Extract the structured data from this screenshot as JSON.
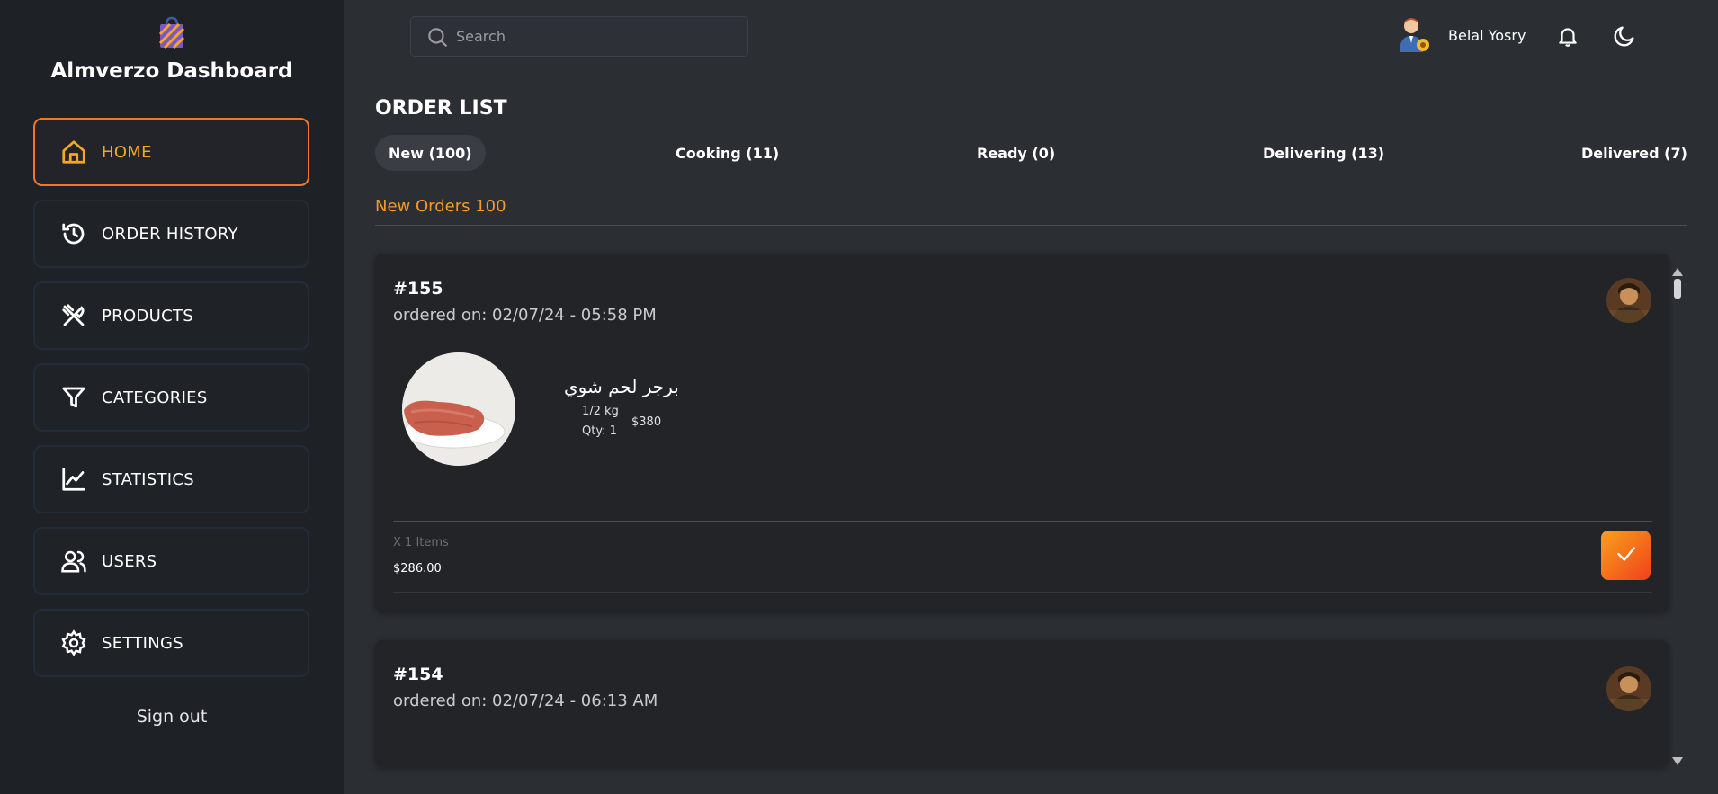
{
  "app": {
    "title": "Almverzo Dashboard",
    "accent": "#f5a623",
    "accent_gradient": [
      "#f7a21b",
      "#f2401b"
    ]
  },
  "sidebar": {
    "items": [
      {
        "label": "HOME",
        "icon": "home-icon",
        "active": true
      },
      {
        "label": "ORDER HISTORY",
        "icon": "history-icon",
        "active": false
      },
      {
        "label": "PRODUCTS",
        "icon": "utensils-icon",
        "active": false
      },
      {
        "label": "CATEGORIES",
        "icon": "filter-icon",
        "active": false
      },
      {
        "label": "STATISTICS",
        "icon": "chart-icon",
        "active": false
      },
      {
        "label": "USERS",
        "icon": "users-icon",
        "active": false
      },
      {
        "label": "SETTINGS",
        "icon": "gear-icon",
        "active": false
      }
    ],
    "signout_label": "Sign out"
  },
  "topbar": {
    "search_placeholder": "Search",
    "user_name": "Belal Yosry"
  },
  "main": {
    "title": "ORDER LIST",
    "tabs": [
      {
        "label": "New (100)",
        "active": true
      },
      {
        "label": "Cooking (11)",
        "active": false
      },
      {
        "label": "Ready (0)",
        "active": false
      },
      {
        "label": "Delivering (13)",
        "active": false
      },
      {
        "label": "Delivered (7)",
        "active": false
      }
    ],
    "section_label": "New Orders 100",
    "orders": [
      {
        "id": "#155",
        "date": "ordered on: 02/07/24 - 05:58 PM",
        "items": [
          {
            "name": "برجر لحم شوي",
            "size": "1/2 kg",
            "qty": "Qty: 1",
            "price": "$380"
          }
        ],
        "items_count": "X 1 Items",
        "total": "$286.00"
      },
      {
        "id": "#154",
        "date": "ordered on: 02/07/24 - 06:13 AM"
      }
    ]
  }
}
